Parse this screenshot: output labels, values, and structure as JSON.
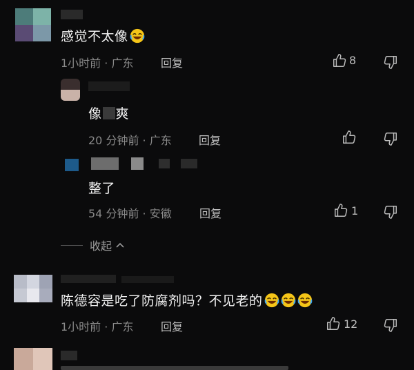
{
  "comments": [
    {
      "text": "感觉不太像",
      "time": "1小时前",
      "location": "广东",
      "reply_label": "回复",
      "likes": "8"
    },
    {
      "text": "像",
      "text_tail": "爽",
      "time": "20 分钟前",
      "location": "广东",
      "reply_label": "回复",
      "likes": ""
    },
    {
      "text": "整了",
      "time": "54 分钟前",
      "location": "安徽",
      "reply_label": "回复",
      "likes": "1"
    },
    {
      "text": "陈德容是吃了防腐剂吗？不见老的",
      "time": "1小时前",
      "location": "广东",
      "reply_label": "回复",
      "likes": "12"
    }
  ],
  "collapse_label": "收起",
  "dot": "·",
  "colors": {
    "bg": "#0b0b0c",
    "text": "#f2f2f2",
    "meta": "#8a8a8a",
    "emoji": "#f5c518"
  },
  "icons": {
    "like": "thumbs-up-icon",
    "dislike": "thumbs-down-icon",
    "laugh": "laughing-emoji-icon",
    "chevron": "chevron-up-icon"
  }
}
